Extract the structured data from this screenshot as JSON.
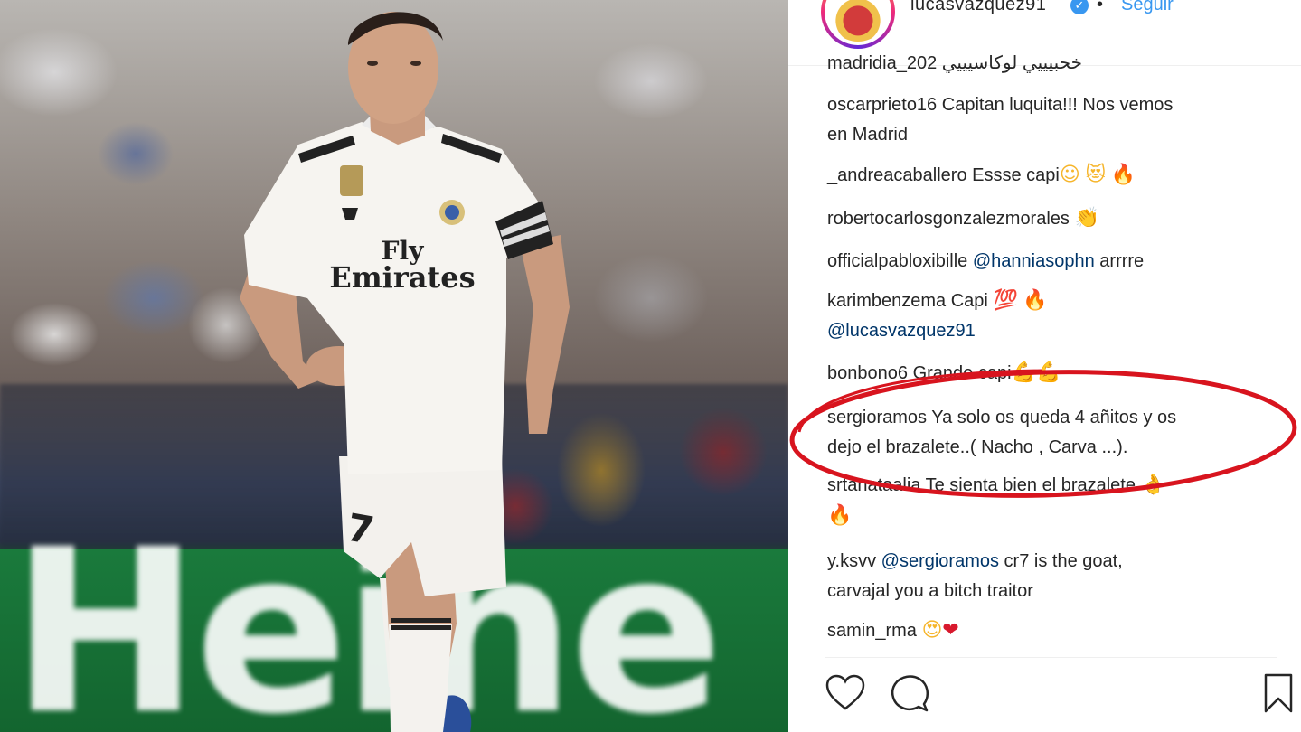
{
  "post": {
    "username": "lucasvazquez91",
    "follow_label": "Seguir",
    "separator": "•"
  },
  "comments": [
    {
      "user": "madridia_202",
      "text": "خحبيييي لوكاسيييي",
      "partial": true
    },
    {
      "user": "oscarprieto16",
      "text": "Capitan luquita!!! Nos vemos",
      "text2": "en Madrid"
    },
    {
      "user": "_andreacaballero",
      "text": "Essse capi"
    },
    {
      "user": "robertocarlosgonzalezmorales",
      "text": ""
    },
    {
      "user": "officialpabloxibille",
      "mention": "@hanniasophn",
      "text": "arrrre"
    },
    {
      "user": "karimbenzema",
      "text": "Capi",
      "mention2": "@lucasvazquez91"
    },
    {
      "user": "bonbon",
      "user_tail": "o6",
      "text": "Grande capi"
    },
    {
      "user": "sergioramos",
      "text": "Ya solo os queda 4 añitos y os",
      "text2": "dejo el brazalete..( Nacho , Carva ...)."
    },
    {
      "user": "srtanataalia",
      "text": "Te sienta bien el brazalete"
    },
    {
      "user": "y.ksvv",
      "mention": "@sergioramos",
      "text": "cr7 is the goat,",
      "text2": "carvajal you a bitch traitor"
    },
    {
      "user": "samin_rma",
      "text": ""
    }
  ],
  "emoji": {
    "smile": "☺",
    "heart_eyes_cat": "😻",
    "fire": "🔥",
    "clap": "👏",
    "hundred": "💯",
    "muscle": "💪",
    "ok_hand": "👌",
    "heart_eyes": "😍",
    "heart": "❤"
  },
  "photo": {
    "banner_text": "Heine",
    "jersey_sponsor_line1": "Fly",
    "jersey_sponsor_line2": "Emirates",
    "shorts_number": "7"
  },
  "colors": {
    "link_blue": "#3897f0",
    "mention_navy": "#003569",
    "highlight_red": "#d8141e",
    "banner_green": "#1a7a3c"
  },
  "icons": [
    "heart-icon",
    "comment-icon",
    "bookmark-icon",
    "verified-icon"
  ]
}
